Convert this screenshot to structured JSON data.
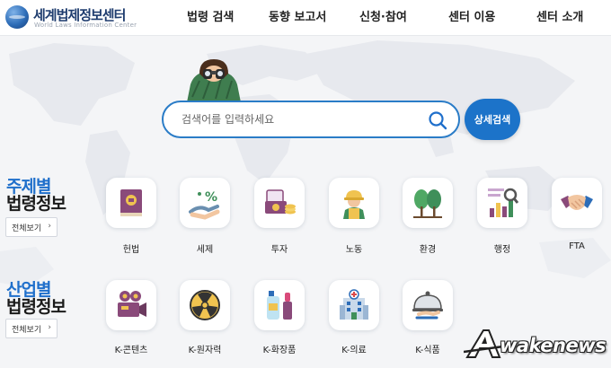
{
  "header": {
    "logo_title": "세계법제정보센터",
    "logo_subtitle": "World Laws Information Center",
    "nav": [
      {
        "label": "법령 검색"
      },
      {
        "label": "동향 보고서"
      },
      {
        "label": "신청·참여"
      },
      {
        "label": "센터 이용"
      },
      {
        "label": "센터 소개"
      }
    ]
  },
  "search": {
    "placeholder": "검색어를 입력하세요",
    "value": "",
    "advanced_label": "상세검색"
  },
  "topics": {
    "title_line1": "주제별",
    "title_line2": "법령정보",
    "more_label": "전체보기",
    "more_arrow": "›",
    "items": [
      {
        "label": "헌법",
        "icon": "constitution-book-icon"
      },
      {
        "label": "세제",
        "icon": "tax-percent-icon"
      },
      {
        "label": "투자",
        "icon": "investment-money-icon"
      },
      {
        "label": "노동",
        "icon": "labor-worker-icon"
      },
      {
        "label": "환경",
        "icon": "environment-trees-icon"
      },
      {
        "label": "행정",
        "icon": "administration-chart-icon"
      },
      {
        "label": "FTA",
        "icon": "fta-handshake-icon"
      }
    ]
  },
  "industries": {
    "title_line1": "산업별",
    "title_line2": "법령정보",
    "more_label": "전체보기",
    "more_arrow": "›",
    "items": [
      {
        "label": "K-콘텐츠",
        "icon": "content-camera-icon"
      },
      {
        "label": "K-원자력",
        "icon": "nuclear-icon"
      },
      {
        "label": "K-화장품",
        "icon": "cosmetics-icon"
      },
      {
        "label": "K-의료",
        "icon": "hospital-icon"
      },
      {
        "label": "K-식품",
        "icon": "food-cloche-icon"
      }
    ]
  },
  "watermark": {
    "text": "wakenews",
    "letter": "A"
  },
  "colors": {
    "accent": "#1f6fcb",
    "button": "#1c73c9",
    "search_border": "#2a7cc7",
    "background": "#f4f5f7"
  }
}
